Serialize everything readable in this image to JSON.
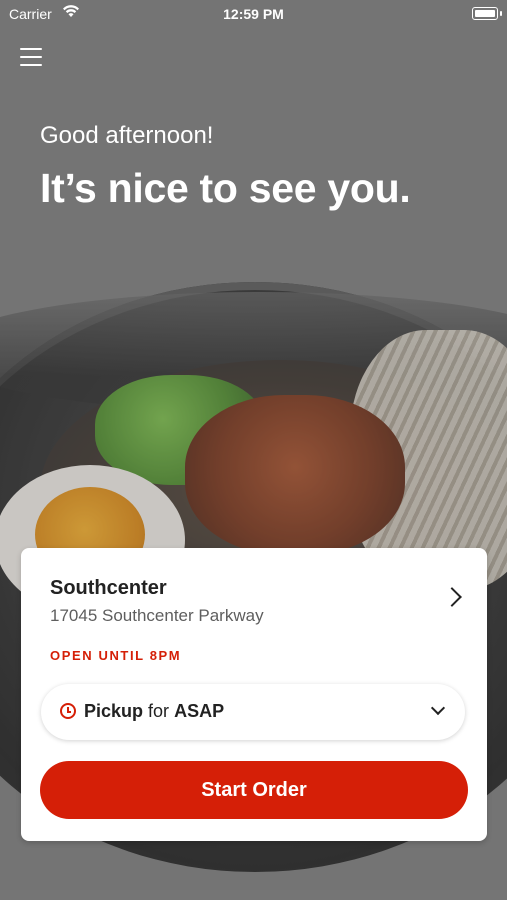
{
  "status_bar": {
    "carrier": "Carrier",
    "time": "12:59 PM"
  },
  "header": {
    "greeting": "Good afternoon!",
    "headline": "It’s nice to see you."
  },
  "location_card": {
    "store_name": "Southcenter",
    "address": "17045 Southcenter Parkway",
    "hours_status": "OPEN UNTIL 8PM",
    "order_mode": "Pickup",
    "connector": "for",
    "order_time": "ASAP",
    "start_order_label": "Start Order"
  },
  "icons": {
    "menu": "hamburger-menu-icon",
    "wifi": "wifi-icon",
    "battery": "battery-icon",
    "store_chevron": "chevron-right-icon",
    "clock": "clock-icon",
    "dropdown": "chevron-down-icon"
  },
  "colors": {
    "accent": "#d51f07",
    "text_primary": "#222222",
    "text_secondary": "#5e5e5e",
    "header_text": "#ffffff"
  }
}
